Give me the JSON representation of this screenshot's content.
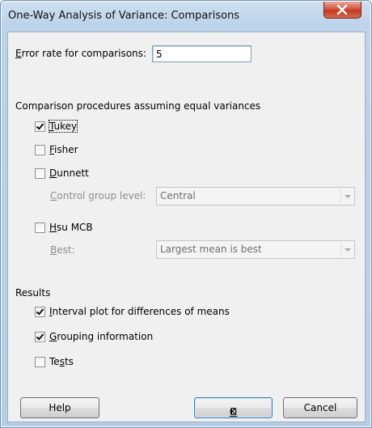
{
  "window": {
    "title": "One-Way Analysis of Variance: Comparisons",
    "close_glyph": "✕"
  },
  "error_rate": {
    "label_first": "E",
    "label_rest": "rror rate for comparisons:",
    "value": "5"
  },
  "equal_var": {
    "heading": "Comparison procedures assuming equal variances",
    "tukey": {
      "u": "T",
      "rest": "ukey",
      "checked": true
    },
    "fisher": {
      "u": "F",
      "rest": "isher",
      "checked": false
    },
    "dunnett": {
      "u": "D",
      "rest": "unnett",
      "checked": false
    },
    "control_group": {
      "u": "C",
      "rest": "ontrol group level:",
      "value": "Central"
    },
    "hsu": {
      "u": "H",
      "rest": "su MCB",
      "checked": false
    },
    "best": {
      "u": "B",
      "rest": "est:",
      "value": "Largest mean is best"
    }
  },
  "results": {
    "heading": "Results",
    "interval": {
      "u": "I",
      "rest": "nterval plot for differences of means",
      "checked": true
    },
    "grouping": {
      "u": "G",
      "rest": "rouping information",
      "checked": true
    },
    "tests": {
      "a": "Te",
      "u": "s",
      "b": "ts",
      "checked": false
    }
  },
  "buttons": {
    "help": "Help",
    "ok_u": "O",
    "ok_rest": "K",
    "cancel": "Cancel"
  }
}
